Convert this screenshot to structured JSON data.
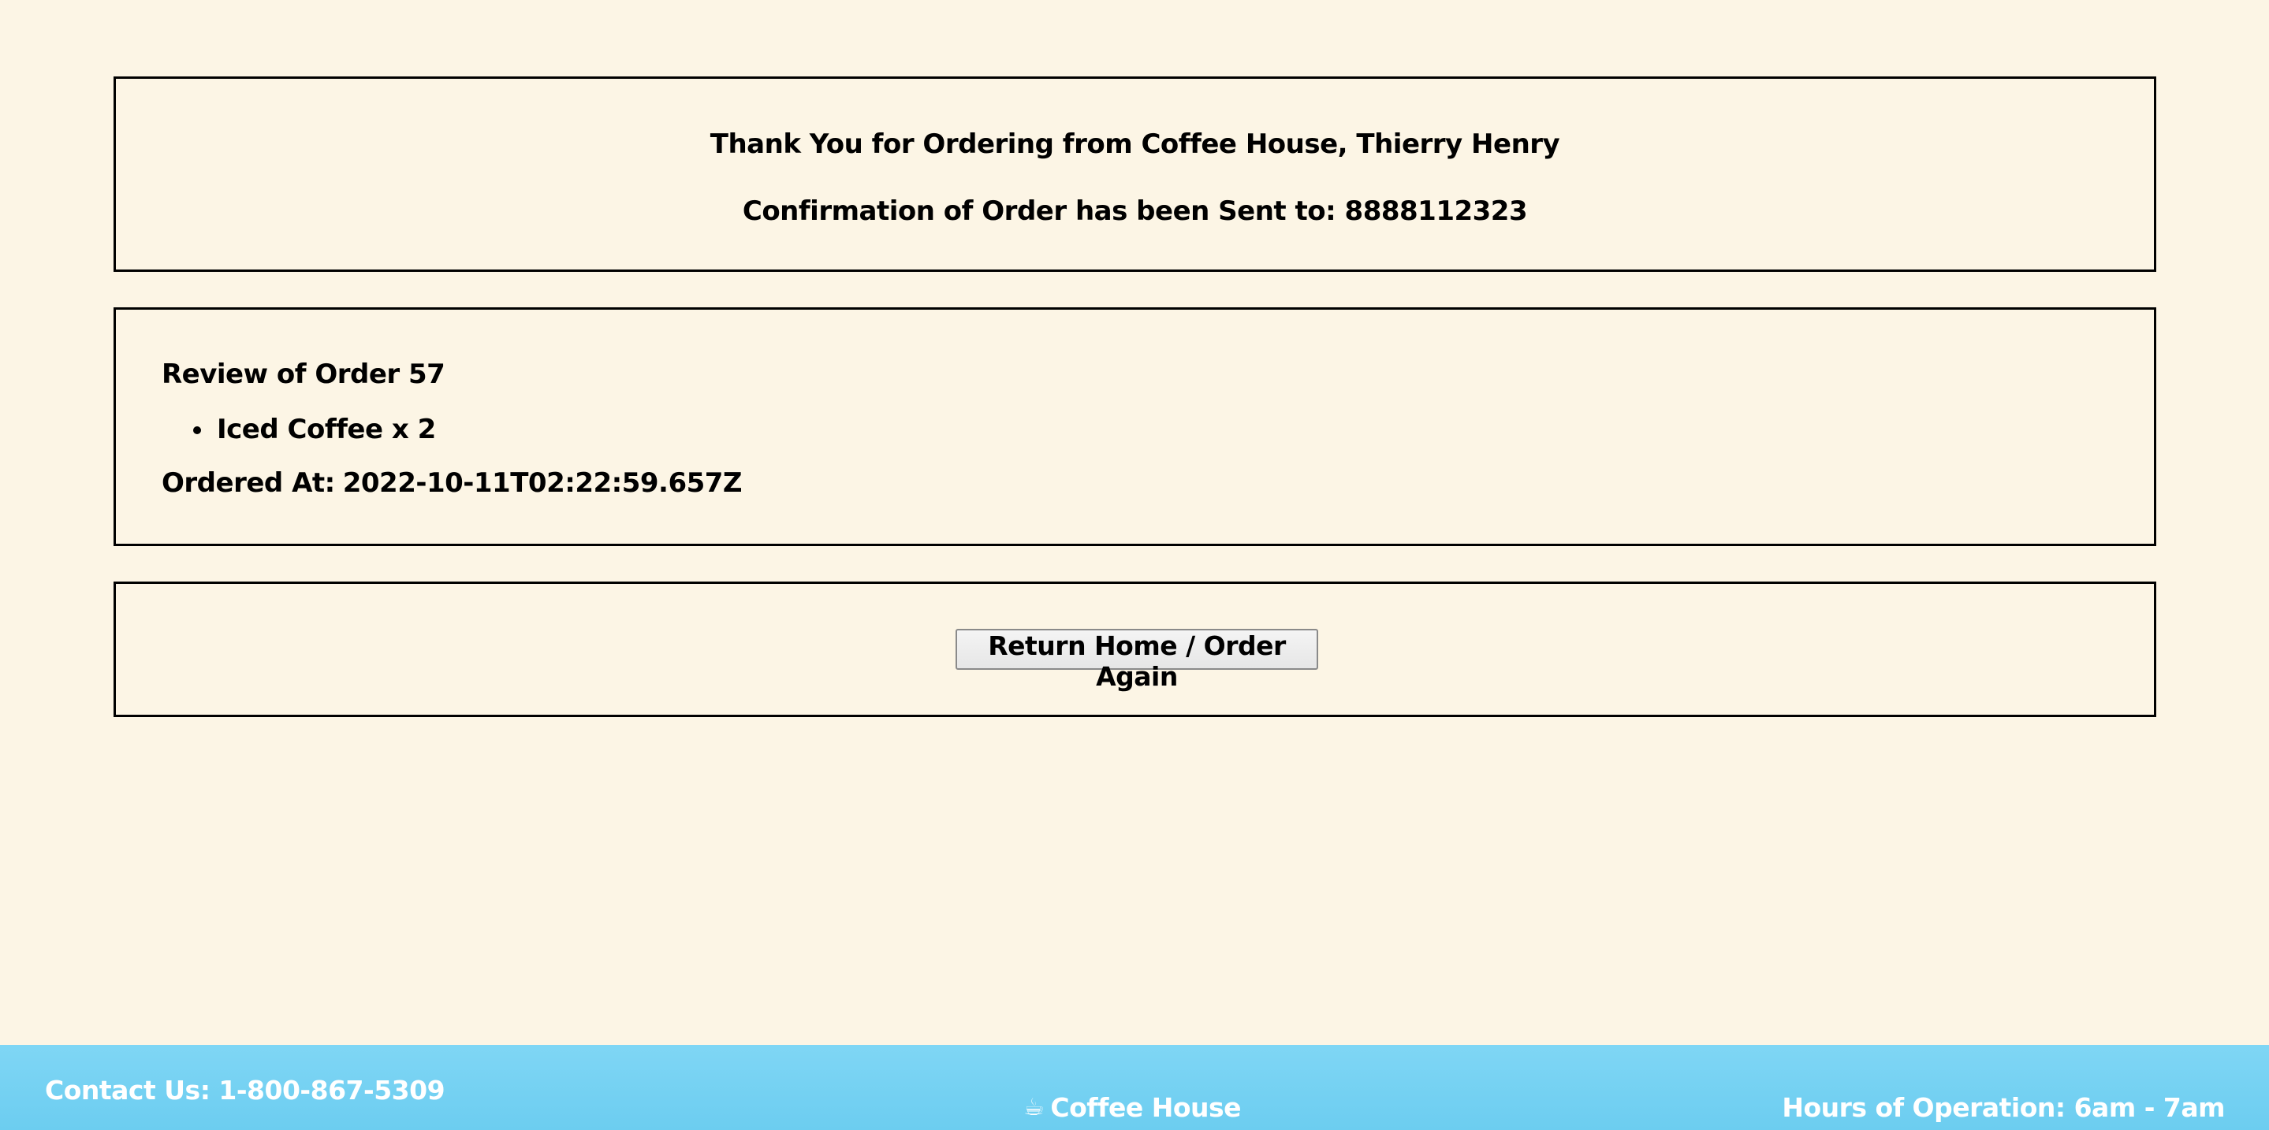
{
  "confirmation": {
    "thank_you": "Thank You for Ordering from Coffee House, Thierry Henry",
    "sent_to": "Confirmation of Order has been Sent to: 8888112323"
  },
  "review": {
    "title": "Review of Order 57",
    "items": [
      {
        "label": "Iced Coffee x 2"
      }
    ],
    "ordered_at_label": "Ordered At:",
    "ordered_at_value": "2022-10-11T02:22:59.657Z"
  },
  "actions": {
    "return_label": "Return Home / Order Again"
  },
  "footer": {
    "contact": "Contact Us: 1-800-867-5309",
    "brand": "Coffee House",
    "brand_icon": "coffee-cup-icon",
    "hours": "Hours of Operation: 6am - 7am"
  },
  "colors": {
    "background": "#fcf5e5",
    "footer": "#74d1f2",
    "border": "#000000"
  }
}
